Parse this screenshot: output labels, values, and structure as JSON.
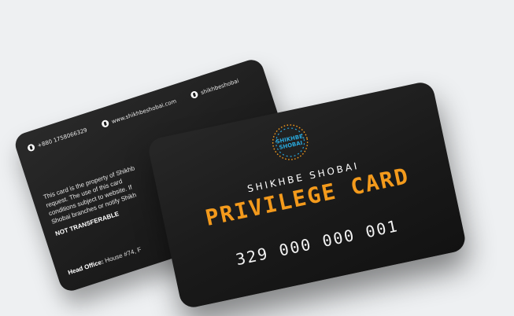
{
  "back_card": {
    "phone": "+880 1758066329",
    "website": "www.shikhbeshobai.com",
    "facebook": "shikhbeshobai",
    "body_lines": [
      "This card is the property of Shikhb",
      "request. The use of this card",
      "conditions subject to website. If",
      "Shobai branches or notify Shikh"
    ],
    "not_transferable": "NOT TRANSFERABLE",
    "head_office_label": "Head Office:",
    "head_office_value": "House #74, F"
  },
  "front_card": {
    "logo_text_line1": "SHIKHBE",
    "logo_text_line2": "SHOBAI",
    "brand_line": "SHIKHBE SHOBAI",
    "title": "PRIVILEGE CARD",
    "card_number": "329 000 000 001"
  },
  "colors": {
    "background": "#eef0f2",
    "card": "#1c1c1c",
    "accent_orange": "#f39a1c",
    "logo_blue": "#2aa6d9"
  }
}
